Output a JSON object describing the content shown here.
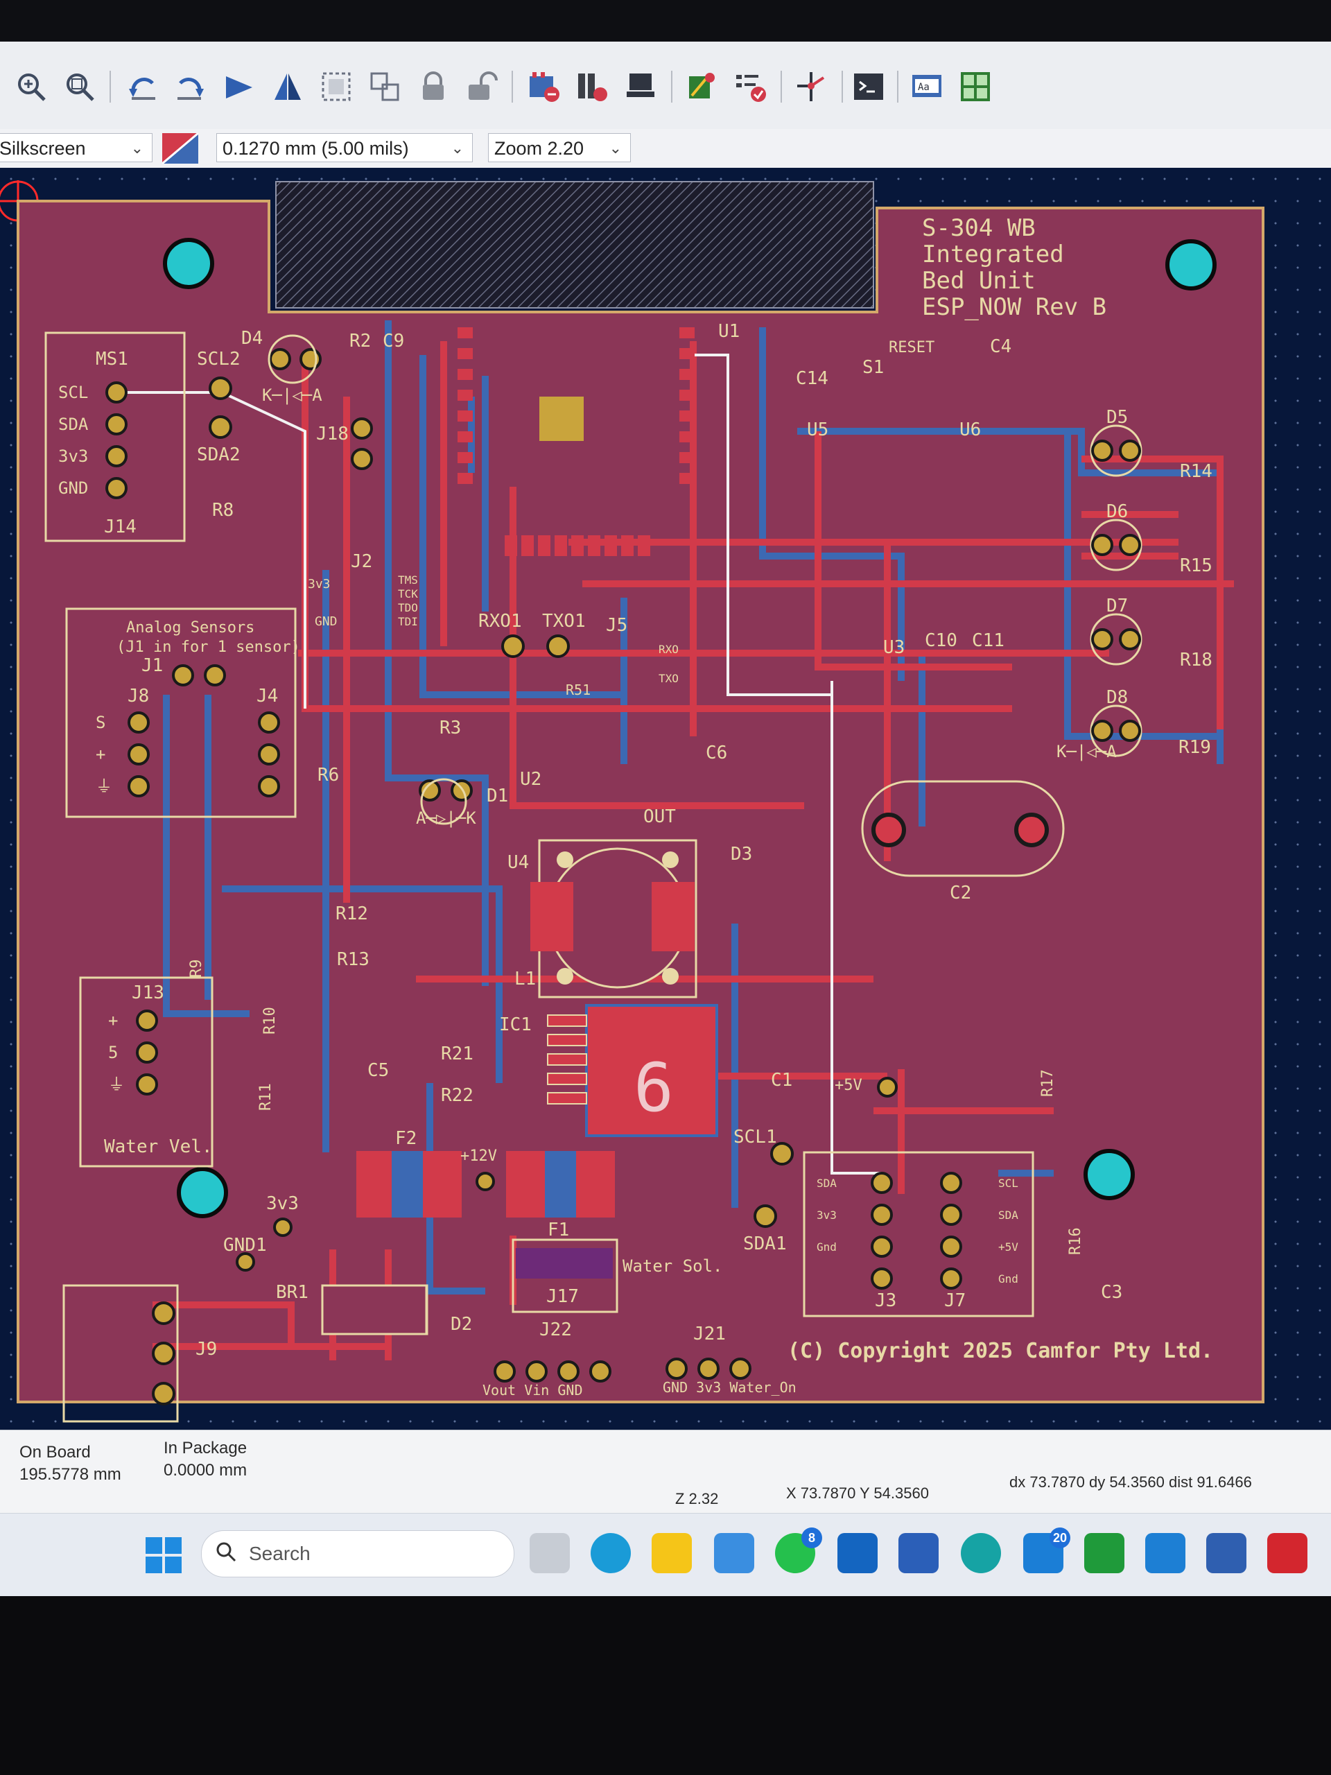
{
  "toolbar": {
    "icons": [
      "zoom-in-icon",
      "zoom-fit-icon",
      "undo-icon",
      "redo-icon",
      "flip-icon",
      "mirror-icon",
      "group-icon",
      "ungroup-icon",
      "lock-icon",
      "unlock-icon",
      "drc-icon",
      "netlist-icon",
      "footprint-icon",
      "route-icon",
      "checklist-icon",
      "router-icon",
      "terminal-icon",
      "text-icon",
      "layers-icon"
    ]
  },
  "options": {
    "layer": "Silkscreen",
    "track_width": "0.1270 mm (5.00 mils)",
    "zoom": "Zoom 2.20"
  },
  "board": {
    "title_lines": [
      "S-304 WB",
      "Integrated",
      "Bed Unit",
      "ESP_NOW  Rev B"
    ],
    "copyright": "(C) Copyright 2025 Camfor Pty Ltd.",
    "analog_box": [
      "Analog Sensors",
      "(J1 in for 1 sensor)"
    ],
    "water_vel": "Water Vel.",
    "water_sol": "Water Sol.",
    "big_number": "6",
    "refs": {
      "ms1": "MS1",
      "scl2": "SCL2",
      "sda2": "SDA2",
      "d4": "D4",
      "r2": "R2",
      "c9": "C9",
      "u1": "U1",
      "reset": "RESET",
      "s1": "S1",
      "c4": "C4",
      "c14": "C14",
      "u5": "U5",
      "u6": "U6",
      "d5": "D5",
      "r14": "R14",
      "d6": "D6",
      "r15": "R15",
      "d7": "D7",
      "r18": "R18",
      "d8": "D8",
      "r19": "R19",
      "j14": "J14",
      "r8": "R8",
      "j18": "J18",
      "j2": "J2",
      "rx01": "RXO1",
      "tx01": "TXO1",
      "j5": "J5",
      "r51": "R51",
      "u3": "U3",
      "c10": "C10",
      "c11": "C11",
      "j1": "J1",
      "j8": "J8",
      "j4": "J4",
      "r6": "R6",
      "r3": "R3",
      "c6": "C6",
      "u2": "U2",
      "out": "OUT",
      "d1": "D1",
      "c2": "C2",
      "u4": "U4",
      "d3": "D3",
      "r12": "R12",
      "r13": "R13",
      "r9": "R9",
      "j13": "J13",
      "r10": "R10",
      "r11": "R11",
      "l1": "L1",
      "ic1": "IC1",
      "r21": "R21",
      "r22": "R22",
      "c5": "C5",
      "c1": "C1",
      "p5v": "+5V",
      "scl1": "SCL1",
      "sda1": "SDA1",
      "f2": "F2",
      "p12v": "+12V",
      "f1": "F1",
      "j17": "J17",
      "r17": "R17",
      "r16": "R16",
      "c3": "C3",
      "j3": "J3",
      "j7": "J7",
      "v3v3": "3v3",
      "gnd1": "GND1",
      "br1": "BR1",
      "d2": "D2",
      "j9": "J9",
      "j22": "J22",
      "j21": "J21"
    },
    "pin_labels": {
      "ms1_pins": [
        "SCL",
        "SDA",
        "3v3",
        "GND"
      ],
      "s": "S",
      "plus": "+",
      "gnd_sym": "⏚",
      "five": "5",
      "j22_pins": "Vout    Vin GND",
      "j21_pins": "GND 3v3  Water_On",
      "j3_pins": [
        "SDA",
        "3v3",
        "Gnd"
      ],
      "j7_pins": [
        "SCL",
        "SDA",
        "+5V",
        "Gnd"
      ],
      "j2_left": [
        "3v3",
        "GND"
      ],
      "j2_right": [
        "TMS",
        "TCK",
        "TDO",
        "TDI"
      ],
      "j5_pins": [
        "RXO",
        "TXO"
      ],
      "diode": "K─|◁─A",
      "diode_d1": "A─▷|─K"
    }
  },
  "status": {
    "on_board_label": "On Board",
    "on_board_value": "195.5778 mm",
    "in_package_label": "In Package",
    "in_package_value": "0.0000 mm",
    "zoom": "Z 2.32",
    "xy": "X 73.7870  Y 54.3560",
    "delta": "dx 73.7870  dy 54.3560  dist 91.6466"
  },
  "taskbar": {
    "search_placeholder": "Search",
    "badges": {
      "whatsapp": "8",
      "azure": "20"
    },
    "apps": [
      "task-view",
      "edge",
      "file-explorer",
      "photos",
      "whatsapp",
      "outlook",
      "word",
      "arduino",
      "azure",
      "excel-green",
      "vscode",
      "kicad",
      "sw2025"
    ]
  },
  "colors": {
    "board": "#8b3657",
    "front_copper": "#d23a4a",
    "back_copper": "#3c69b3",
    "silk": "#e8d9a6",
    "pad": "#c9a43c",
    "mount": "#26c6cc",
    "canvas": "#07173a"
  }
}
